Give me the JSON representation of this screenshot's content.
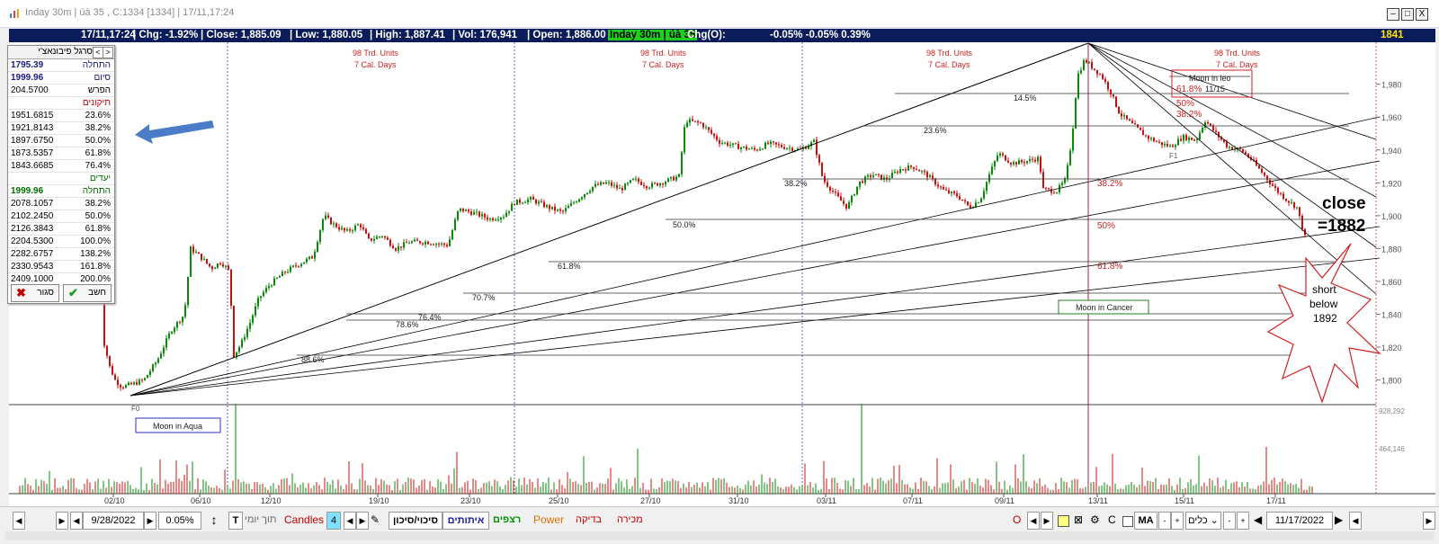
{
  "window": {
    "title": "Inday 30m | úà 35 , C:1334  [1334]  | 17/11,17:24",
    "minimize": "–",
    "maximize": "□",
    "close": "X"
  },
  "infobar": {
    "time": "17/11,17:24",
    "chg": "| Chg: -1.92%",
    "close": "| Close: 1,885.09",
    "low": "| Low: 1,880.05",
    "high": "| High: 1,887.41",
    "vol": "| Vol: 176,941",
    "open": "| Open: 1,886.00",
    "symbol": "Inday 30m | úà 35",
    "chgo": "Chg(O):",
    "chgo_vals": "-0.05% -0.05% 0.39%",
    "last": "1841"
  },
  "fib_panel": {
    "title": "סרגל פיבונאצ'י",
    "prev": "<",
    "next": ">",
    "start_value": "1795.39",
    "start_label": "התחלה",
    "end_value": "1999.96",
    "end_label": "סיום",
    "diff_value": "204.5700",
    "diff_label": "הפרש",
    "retrace_header": "תיקונים",
    "retracements": [
      {
        "value": "1951.6815",
        "pct": "23.6%"
      },
      {
        "value": "1921.8143",
        "pct": "38.2%"
      },
      {
        "value": "1897.6750",
        "pct": "50.0%"
      },
      {
        "value": "1873.5357",
        "pct": "61.8%"
      },
      {
        "value": "1843.6685",
        "pct": "76.4%"
      }
    ],
    "targets_header": "יעדים",
    "target_start_value": "1999.96",
    "target_start_label": "התחלה",
    "targets": [
      {
        "value": "2078.1057",
        "pct": "38.2%"
      },
      {
        "value": "2102.2450",
        "pct": "50.0%"
      },
      {
        "value": "2126.3843",
        "pct": "61.8%"
      },
      {
        "value": "2204.5300",
        "pct": "100.0%"
      },
      {
        "value": "2282.6757",
        "pct": "138.2%"
      },
      {
        "value": "2330.9543",
        "pct": "161.8%"
      },
      {
        "value": "2409.1000",
        "pct": "200.0%"
      }
    ],
    "close_btn": "סגור",
    "calc_btn": "חשב"
  },
  "chart_data": {
    "type": "candlestick",
    "x_ticks": [
      "02/10",
      "06/10",
      "12/10",
      "19/10",
      "23/10",
      "25/10",
      "27/10",
      "31/10",
      "03/11",
      "07/11",
      "09/11",
      "13/11",
      "15/11",
      "17/11"
    ],
    "y_ticks": [
      1800,
      1820,
      1840,
      1860,
      1880,
      1900,
      1920,
      1940,
      1960,
      1980
    ],
    "y_tick_labels": [
      "1,800",
      "1,820",
      "1,840",
      "1,860",
      "1,880",
      "1,900",
      "1,920",
      "1,940",
      "1,960",
      "1,980"
    ],
    "ylim": [
      1785,
      2005
    ],
    "volume_ticks": [
      "928,292",
      "464,146"
    ],
    "fib_levels": [
      {
        "label": "14.5%"
      },
      {
        "label": "23.6%"
      },
      {
        "label": "38.2%"
      },
      {
        "label": "50.0%"
      },
      {
        "label": "61.8%"
      },
      {
        "label": "70.7%"
      },
      {
        "label": "76.4%"
      },
      {
        "label": "78.6%"
      },
      {
        "label": "88.6%"
      }
    ],
    "fib_red_labels": [
      "38.2%",
      "50%",
      "61.8%"
    ],
    "fib_box_labels": [
      "61.8%",
      "50%",
      "38.2%"
    ],
    "cycle_labels": [
      {
        "line1": "98 Trd. Units",
        "line2": "7 Cal. Days"
      },
      {
        "line1": "98 Trd. Units",
        "line2": "7 Cal. Days"
      },
      {
        "line1": "98 Trd. Units",
        "line2": "7 Cal. Days"
      },
      {
        "line1": "98 Trd. Units",
        "line2": "7 Cal. Days"
      }
    ],
    "annotations": {
      "moon_aqua": "Moon in Aqua",
      "moon_cancer": "Moon in Cancer",
      "moon_leo": "Moon in leo",
      "moon_leo_date": "11/15",
      "close_note_1": "close",
      "close_note_2": "=1882",
      "short_1": "short",
      "short_2": "below",
      "short_3": "1892",
      "f0": "F0",
      "f1": "F1"
    },
    "last_close": 1885.09
  },
  "bottombar": {
    "date_from": "9/28/2022",
    "zoom": "0.05%",
    "t_btn": "T",
    "intraday": "תוך יומי",
    "candles_label": "Candles",
    "candles_value": "4",
    "tabs": [
      "סיכוי/סיכון",
      "איתותים",
      "רצפים",
      "Power",
      "בדיקה",
      "מכירה"
    ],
    "o_btn": "O",
    "c_btn": "C",
    "ma": "MA",
    "tools": "כלים",
    "date_to": "11/17/2022",
    "colors": {
      "tab_active": "#000000",
      "tab_signals": "#1a1aa0",
      "tab_streaks": "#009000",
      "tab_power": "#e07000",
      "tab_check": "#c00000",
      "tab_sell": "#c00000"
    }
  }
}
